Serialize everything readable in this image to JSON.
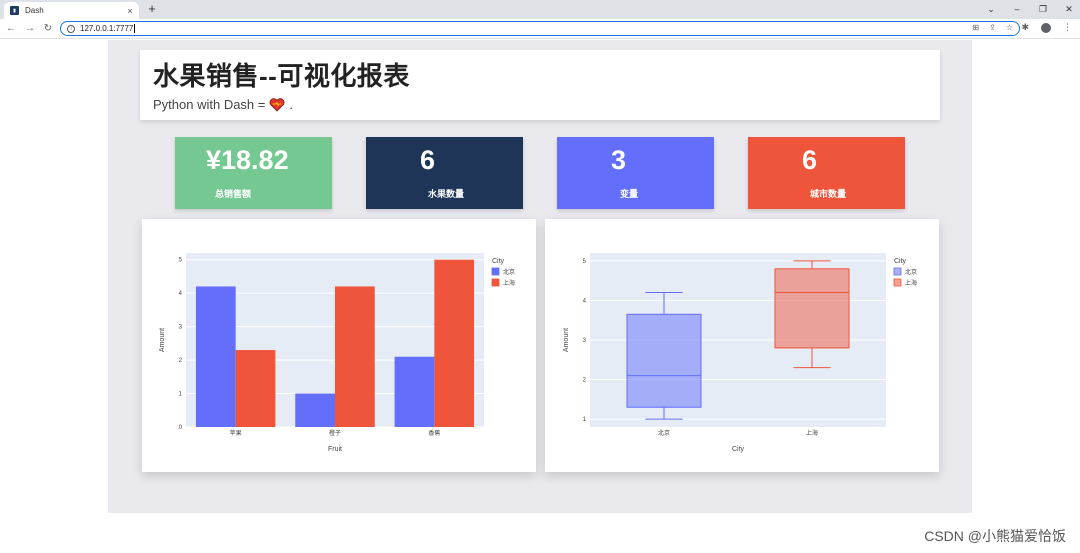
{
  "browser": {
    "tab_title": "Dash",
    "url": "127.0.0.1:7777",
    "new_tab": "+",
    "close": "×"
  },
  "header": {
    "title": "水果销售--可视化报表",
    "subtitle_text": "Python with Dash =",
    "subtitle_tail": "."
  },
  "stats": [
    {
      "value": "¥18.82",
      "label": "总销售额",
      "color": "#76c893"
    },
    {
      "value": "6",
      "label": "水果数量",
      "color": "#1e3557"
    },
    {
      "value": "3",
      "label": "变量",
      "color": "#636efa"
    },
    {
      "value": "6",
      "label": "城市数量",
      "color": "#ef553b"
    }
  ],
  "colors": {
    "blue": "#636efa",
    "red": "#ef553b",
    "plot_bg": "#e5ecf6"
  },
  "chart_data": [
    {
      "type": "bar",
      "categories": [
        "苹果",
        "橙子",
        "香蕉"
      ],
      "series": [
        {
          "name": "北京",
          "values": [
            4.2,
            1,
            2.1
          ]
        },
        {
          "name": "上海",
          "values": [
            2.3,
            4.2,
            5
          ]
        }
      ],
      "xlabel": "Fruit",
      "ylabel": "Amount",
      "legend_title": "City",
      "ylim": [
        0,
        5.2
      ],
      "yticks": [
        "0",
        "1",
        "2",
        "3",
        "4",
        "5"
      ]
    },
    {
      "type": "box",
      "categories": [
        "北京",
        "上海"
      ],
      "series": [
        {
          "name": "北京",
          "min": 1,
          "q1": 1.3,
          "median": 2.1,
          "q3": 3.65,
          "max": 4.2
        },
        {
          "name": "上海",
          "min": 2.3,
          "q1": 2.8,
          "median": 4.2,
          "q3": 4.8,
          "max": 5
        }
      ],
      "xlabel": "City",
      "ylabel": "Amount",
      "legend_title": "City",
      "ylim": [
        0.8,
        5.2
      ],
      "yticks": [
        "1",
        "2",
        "3",
        "4",
        "5"
      ]
    }
  ],
  "watermark": "CSDN @小熊猫爱恰饭"
}
